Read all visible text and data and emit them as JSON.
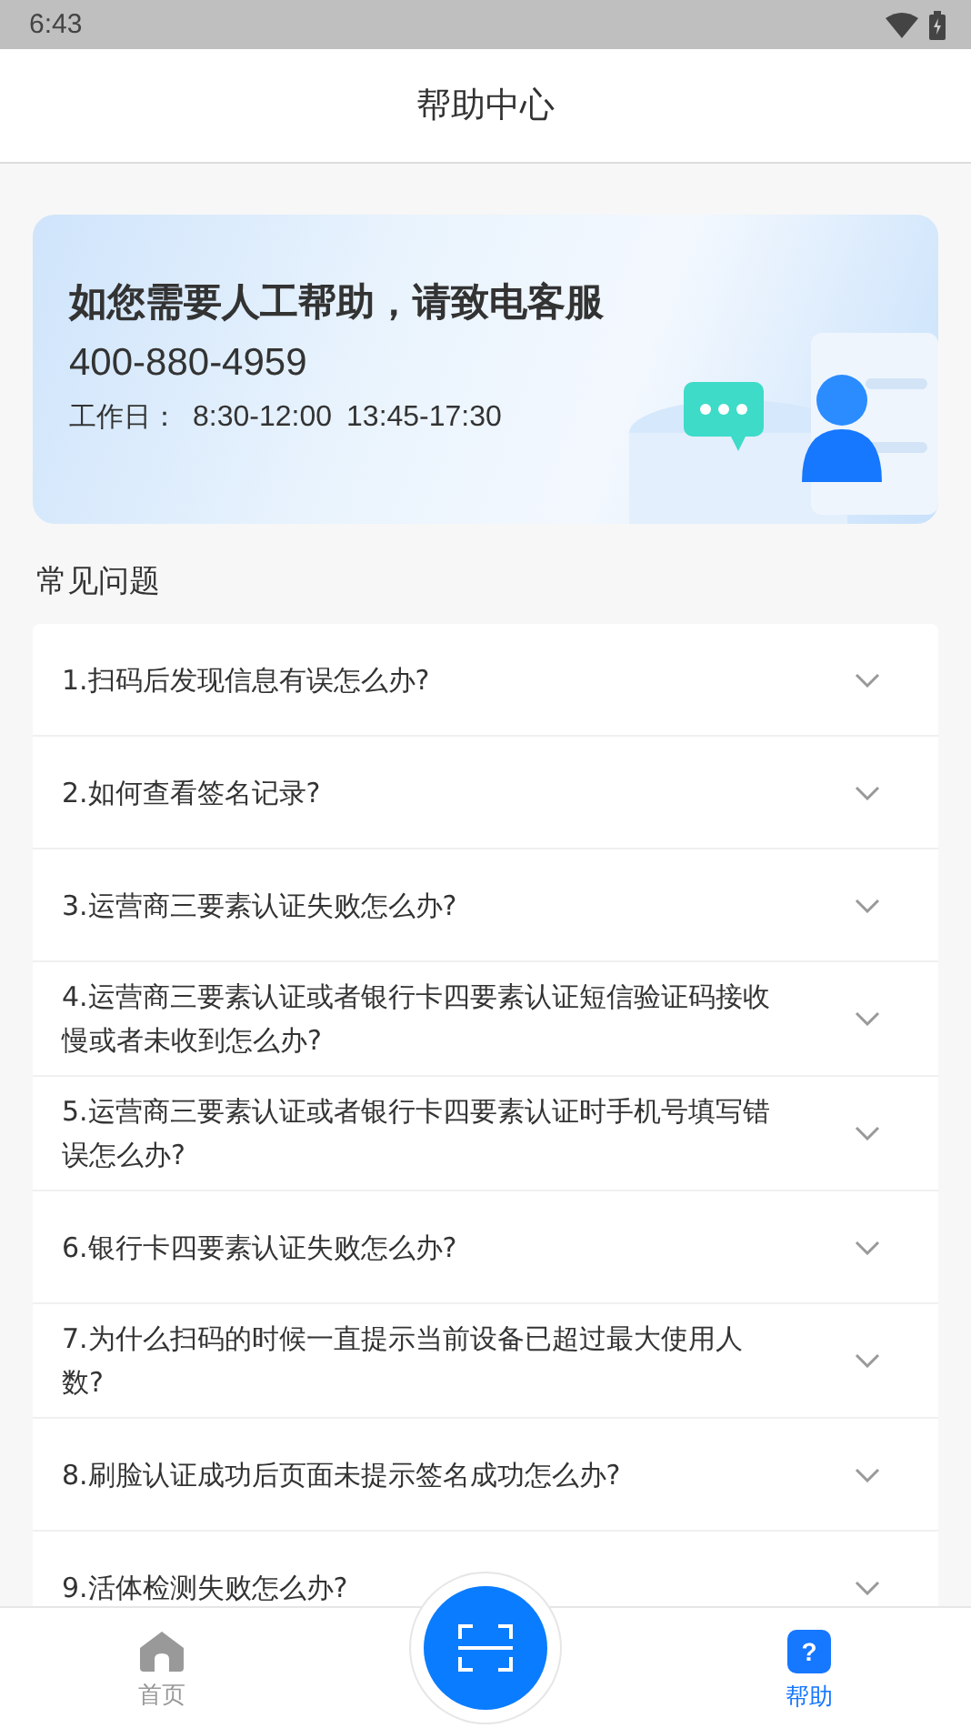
{
  "status_bar": {
    "time": "6:43"
  },
  "header": {
    "title": "帮助中心"
  },
  "banner": {
    "headline": "如您需要人工帮助，请致电客服",
    "phone": "400-880-4959",
    "hours_label": "工作日：",
    "hours": [
      "8:30-12:00",
      "13:45-17:30"
    ]
  },
  "faq": {
    "title": "常见问题",
    "items": [
      {
        "question": "1.扫码后发现信息有误怎么办?",
        "expanded": false
      },
      {
        "question": "2.如何查看签名记录?",
        "expanded": false
      },
      {
        "question": "3.运营商三要素认证失败怎么办?",
        "expanded": false
      },
      {
        "question": "4.运营商三要素认证或者银行卡四要素认证短信验证码接收慢或者未收到怎么办?",
        "expanded": false
      },
      {
        "question": "5.运营商三要素认证或者银行卡四要素认证时手机号填写错误怎么办?",
        "expanded": false
      },
      {
        "question": "6.银行卡四要素认证失败怎么办?",
        "expanded": false
      },
      {
        "question": "7.为什么扫码的时候一直提示当前设备已超过最大使用人数?",
        "expanded": false
      },
      {
        "question": "8.刷脸认证成功后页面未提示签名成功怎么办?",
        "expanded": false
      },
      {
        "question": "9.活体检测失败怎么办?",
        "expanded": false
      }
    ]
  },
  "bottom_nav": {
    "tabs": [
      {
        "kind": "home",
        "label": "首页",
        "selected": false
      },
      {
        "kind": "scan"
      },
      {
        "kind": "help",
        "icon": "?",
        "label": "帮助",
        "selected": true
      }
    ]
  }
}
